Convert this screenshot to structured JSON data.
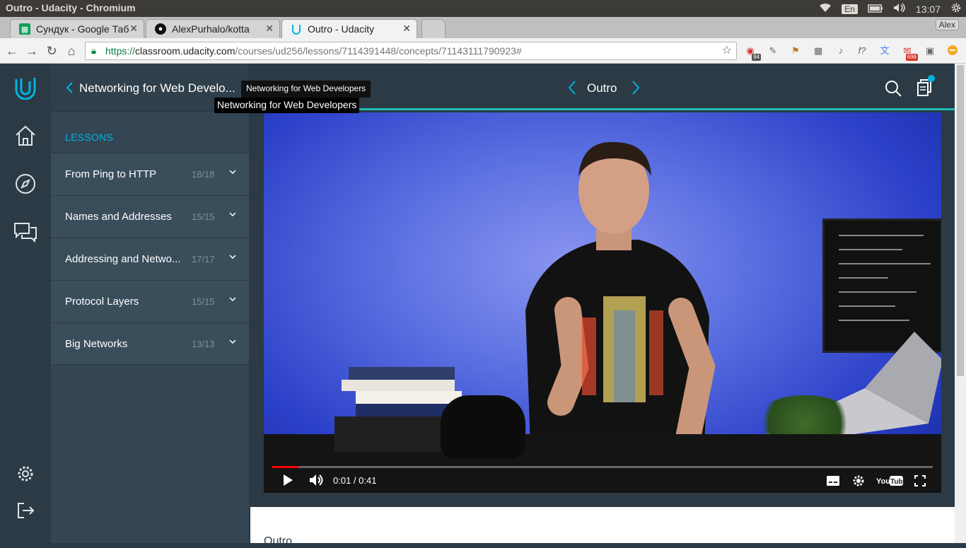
{
  "os": {
    "window_title": "Outro - Udacity - Chromium",
    "lang": "En",
    "clock": "13:07"
  },
  "tabs": [
    {
      "label": "Сундук - Google Таб",
      "icon": "sheets-icon",
      "active": false
    },
    {
      "label": "AlexPurhalo/kotta",
      "icon": "github-icon",
      "active": false
    },
    {
      "label": "Outro - Udacity",
      "icon": "udacity-icon",
      "active": true
    }
  ],
  "profile_name": "Alex",
  "address": {
    "scheme": "https://",
    "host": "classroom.udacity.com",
    "path": "/courses/ud256/lessons/7114391448/concepts/71143111790923#"
  },
  "extensions": {
    "badge_1": "94",
    "badge_2": "698"
  },
  "sidebar": {
    "course_title": "Networking for Web Develo...",
    "lessons_heading": "LESSONS",
    "lessons": [
      {
        "name": "From Ping to HTTP",
        "count": "18/18"
      },
      {
        "name": "Names and Addresses",
        "count": "15/15"
      },
      {
        "name": "Addressing and Netwo...",
        "count": "17/17"
      },
      {
        "name": "Protocol Layers",
        "count": "15/15"
      },
      {
        "name": "Big Networks",
        "count": "13/13"
      }
    ]
  },
  "tooltips": {
    "small": "Networking for Web Developers",
    "large": "Networking for Web Developers"
  },
  "concept": {
    "title": "Outro"
  },
  "video": {
    "time": "0:01 / 0:41",
    "progress": 0.04
  },
  "below_video": {
    "title": "Outro"
  },
  "colors": {
    "accent": "#02b3e4",
    "teal_rule": "#1bbfb5",
    "rail_bg": "#2b3a44",
    "sidebar_bg": "#344654"
  }
}
